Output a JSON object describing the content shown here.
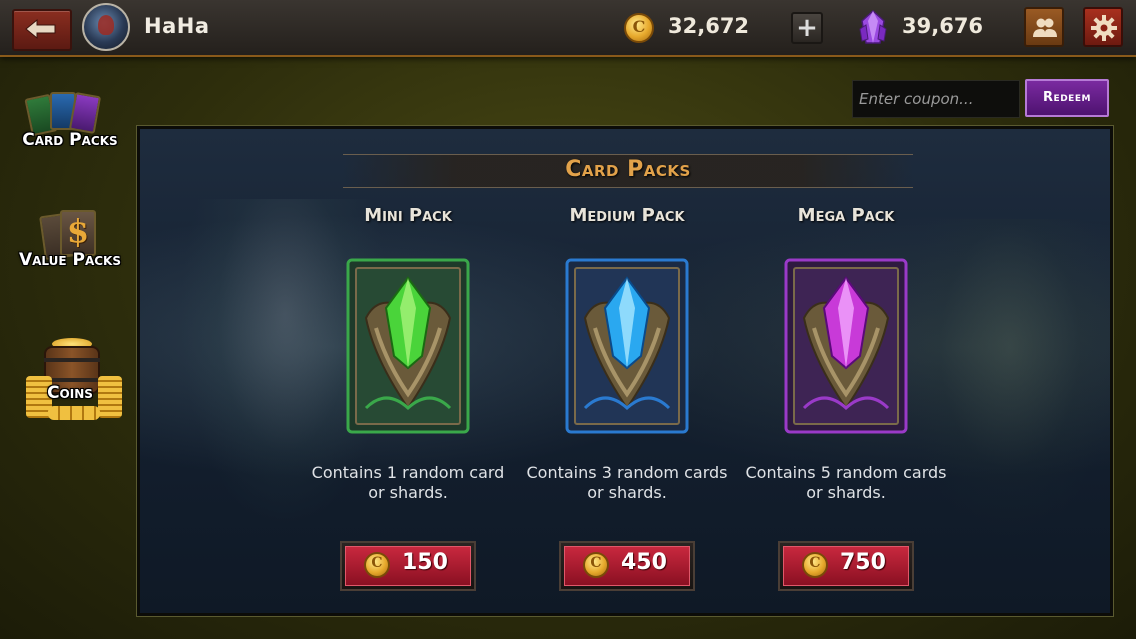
{
  "header": {
    "player_name": "HaHa",
    "coins": "32,672",
    "gems": "39,676",
    "plus_label": "+"
  },
  "sidebar": {
    "items": [
      {
        "label": "Card Packs",
        "icon": "card-packs-icon"
      },
      {
        "label": "Value Packs",
        "icon": "value-packs-icon"
      },
      {
        "label": "Coins",
        "icon": "coins-barrel-icon"
      }
    ]
  },
  "coupon": {
    "placeholder": "Enter coupon...",
    "redeem_label": "Redeem"
  },
  "panel": {
    "title": "Card Packs",
    "packs": [
      {
        "name": "Mini Pack",
        "desc_line1": "Contains 1 random card",
        "desc_line2": "or shards.",
        "price": "150",
        "color": "#3aa84a"
      },
      {
        "name": "Medium Pack",
        "desc_line1": "Contains 3 random cards",
        "desc_line2": "or shards.",
        "price": "450",
        "color": "#2a7ad0"
      },
      {
        "name": "Mega Pack",
        "desc_line1": "Contains 5 random cards",
        "desc_line2": "or shards.",
        "price": "750",
        "color": "#9a3ac8"
      }
    ]
  },
  "colors": {
    "accent_gold": "#e2a24a",
    "price_red": "#b81e34",
    "redeem_purple": "#6a1e90"
  }
}
